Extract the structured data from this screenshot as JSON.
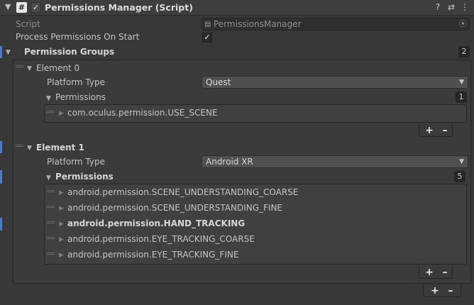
{
  "header": {
    "title": "Permissions Manager (Script)",
    "script_icon": "#",
    "enabled_check": "✓",
    "help_icon": "?",
    "preset_icon": "⇄",
    "menu_icon": "⋮"
  },
  "script_field": {
    "label": "Script",
    "value": "PermissionsManager"
  },
  "process_on_start": {
    "label": "Process Permissions On Start",
    "check": "✓"
  },
  "permission_groups": {
    "label": "Permission Groups",
    "count": "2",
    "elements": [
      {
        "label": "Element 0",
        "platform_type_label": "Platform Type",
        "platform_type_value": "Quest",
        "permissions_label": "Permissions",
        "permissions_count": "1",
        "permissions": [
          "com.oculus.permission.USE_SCENE"
        ]
      },
      {
        "label": "Element 1",
        "platform_type_label": "Platform Type",
        "platform_type_value": "Android XR",
        "permissions_label": "Permissions",
        "permissions_count": "5",
        "permissions": [
          "android.permission.SCENE_UNDERSTANDING_COARSE",
          "android.permission.SCENE_UNDERSTANDING_FINE",
          "android.permission.HAND_TRACKING",
          "android.permission.EYE_TRACKING_COARSE",
          "android.permission.EYE_TRACKING_FINE"
        ]
      }
    ]
  },
  "buttons": {
    "add": "+",
    "remove": "–"
  },
  "colors": {
    "accent_bar": "#4d7cc4",
    "panel_bg": "#383838",
    "dropdown_bg": "#505050"
  }
}
